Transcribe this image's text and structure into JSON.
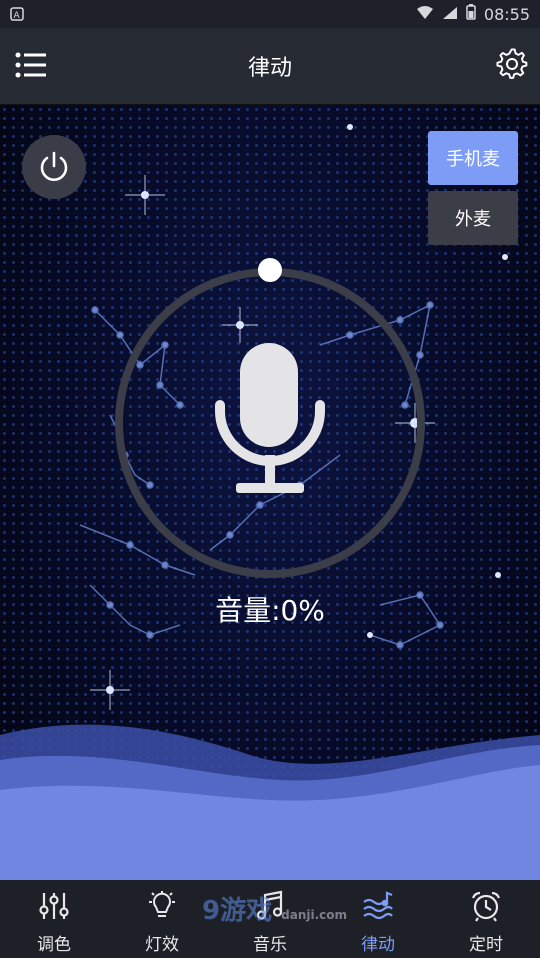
{
  "status_bar": {
    "time": "08:55"
  },
  "header": {
    "title": "律动"
  },
  "mode_buttons": {
    "phone_mic": "手机麦",
    "external_mic": "外麦",
    "selected": "phone_mic"
  },
  "volume": {
    "label": "音量:0%",
    "value": 0
  },
  "bottom_nav": [
    {
      "label": "调色",
      "icon": "sliders-icon"
    },
    {
      "label": "灯效",
      "icon": "bulb-icon"
    },
    {
      "label": "音乐",
      "icon": "music-note-icon"
    },
    {
      "label": "律动",
      "icon": "wave-icon",
      "active": true
    },
    {
      "label": "定时",
      "icon": "alarm-clock-icon"
    }
  ],
  "watermark": {
    "text": "9游戏",
    "sub": "danji.com"
  },
  "colors": {
    "accent": "#7d9cf6",
    "appbar": "#262a33",
    "nav": "#1e2027"
  }
}
